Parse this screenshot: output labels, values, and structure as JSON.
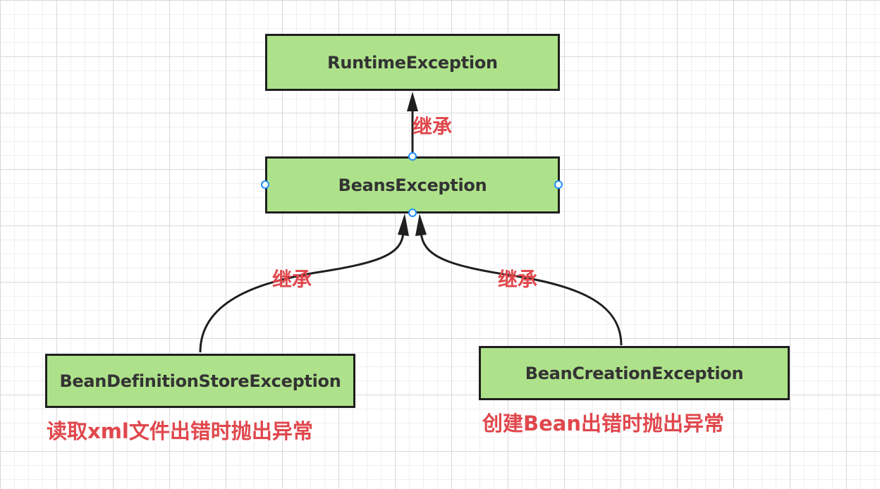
{
  "nodes": {
    "runtime": "RuntimeException",
    "beans": "BeansException",
    "definition_store": "BeanDefinitionStoreException",
    "creation": "BeanCreationException"
  },
  "edges": {
    "beans_to_runtime": "继承",
    "definition_store_to_beans": "继承",
    "creation_to_beans": "继承"
  },
  "captions": {
    "definition_store": "读取xml文件出错时抛出异常",
    "creation": "创建Bean出错时抛出异常"
  },
  "colors": {
    "node_fill": "#aee28a",
    "node_border": "#1f1f1f",
    "label_text": "#e0474c",
    "selection_handle": "#1e8fff"
  }
}
